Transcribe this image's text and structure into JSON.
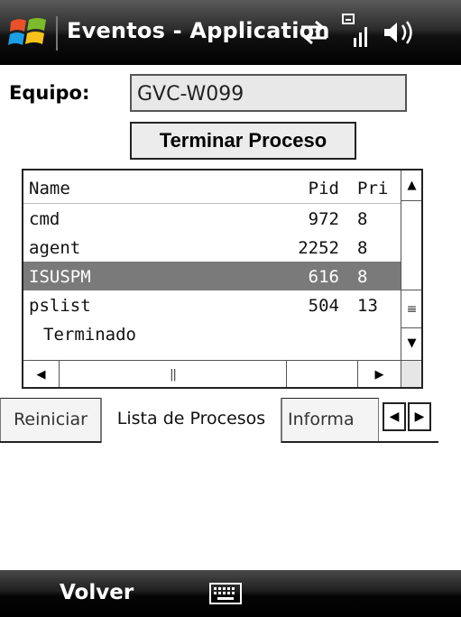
{
  "titlebar": {
    "title": "Eventos - Application",
    "icons": [
      "windows-start-icon",
      "sync-arrows-icon",
      "signal-strength-icon",
      "speaker-volume-icon"
    ]
  },
  "form": {
    "equipo_label": "Equipo:",
    "equipo_value": "GVC-W099",
    "terminar_label": "Terminar Proceso"
  },
  "process_list": {
    "columns": {
      "name": "Name",
      "pid": "Pid",
      "pri": "Pri"
    },
    "rows": [
      {
        "name": "cmd",
        "pid": "972",
        "pri": "8"
      },
      {
        "name": "agent",
        "pid": "2252",
        "pri": "8"
      },
      {
        "name": "ISUSPM",
        "pid": "616",
        "pri": "8"
      },
      {
        "name": "pslist",
        "pid": "504",
        "pri": "13"
      }
    ],
    "selected_row": "ISUSPM",
    "status": "Terminado"
  },
  "tabs": {
    "items": [
      {
        "label": "Reiniciar"
      },
      {
        "label": "Lista de Procesos"
      },
      {
        "label": "Informa"
      }
    ],
    "active": "Lista de Procesos"
  },
  "softkeys": {
    "left": "Volver",
    "center_icon": "keyboard-icon"
  },
  "colors": {
    "titlebar": "#000000",
    "selected_row": "#7a7a7a",
    "field_bg": "#e8e8e8"
  }
}
